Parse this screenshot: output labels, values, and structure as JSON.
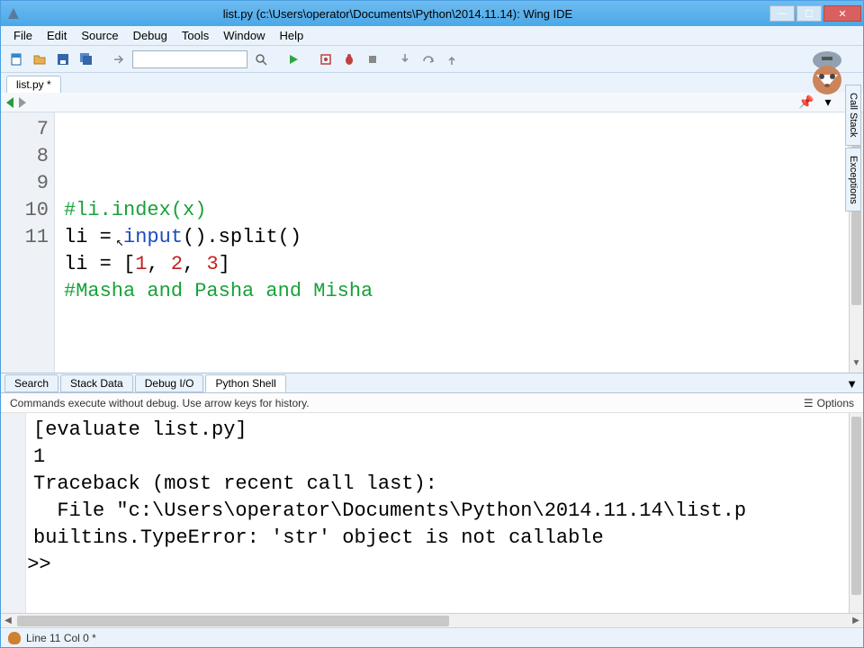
{
  "title": "list.py (c:\\Users\\operator\\Documents\\Python\\2014.11.14): Wing IDE",
  "menus": [
    "File",
    "Edit",
    "Source",
    "Debug",
    "Tools",
    "Window",
    "Help"
  ],
  "file_tab": "list.py *",
  "side_tabs": [
    "Call Stack",
    "Exceptions"
  ],
  "toolbar_search_placeholder": "",
  "nav_buttons": {
    "pin": "📌",
    "down": "▾",
    "close": "✖"
  },
  "editor": {
    "line_numbers": [
      "7",
      "8",
      "9",
      "10",
      "11"
    ],
    "lines": [
      {
        "type": "comment",
        "text": "#li.index(x)"
      },
      {
        "type": "code",
        "segments": [
          {
            "t": "li = ",
            "c": ""
          },
          {
            "t": "input",
            "c": "c-builtin"
          },
          {
            "t": "().split()",
            "c": ""
          }
        ]
      },
      {
        "type": "code",
        "segments": [
          {
            "t": "li = [",
            "c": ""
          },
          {
            "t": "1",
            "c": "c-num"
          },
          {
            "t": ", ",
            "c": ""
          },
          {
            "t": "2",
            "c": "c-num"
          },
          {
            "t": ", ",
            "c": ""
          },
          {
            "t": "3",
            "c": "c-num"
          },
          {
            "t": "]",
            "c": ""
          }
        ]
      },
      {
        "type": "comment",
        "text": "#Masha and Pasha and Misha"
      },
      {
        "type": "code",
        "segments": [
          {
            "t": "",
            "c": ""
          }
        ]
      }
    ]
  },
  "panel_tabs": [
    "Search",
    "Stack Data",
    "Debug I/O",
    "Python Shell"
  ],
  "panel_active": 3,
  "shell_info": "Commands execute without debug.  Use arrow keys for history.",
  "shell_options": "Options",
  "shell_lines": [
    "[evaluate list.py]",
    "1",
    "Traceback (most recent call last):",
    "  File \"c:\\Users\\operator\\Documents\\Python\\2014.11.14\\list.p",
    "builtins.TypeError: 'str' object is not callable"
  ],
  "shell_prompt": ">>>",
  "statusbar": "Line 11 Col 0 *",
  "win_buttons": {
    "min": "—",
    "max": "☐",
    "close": "✕"
  }
}
